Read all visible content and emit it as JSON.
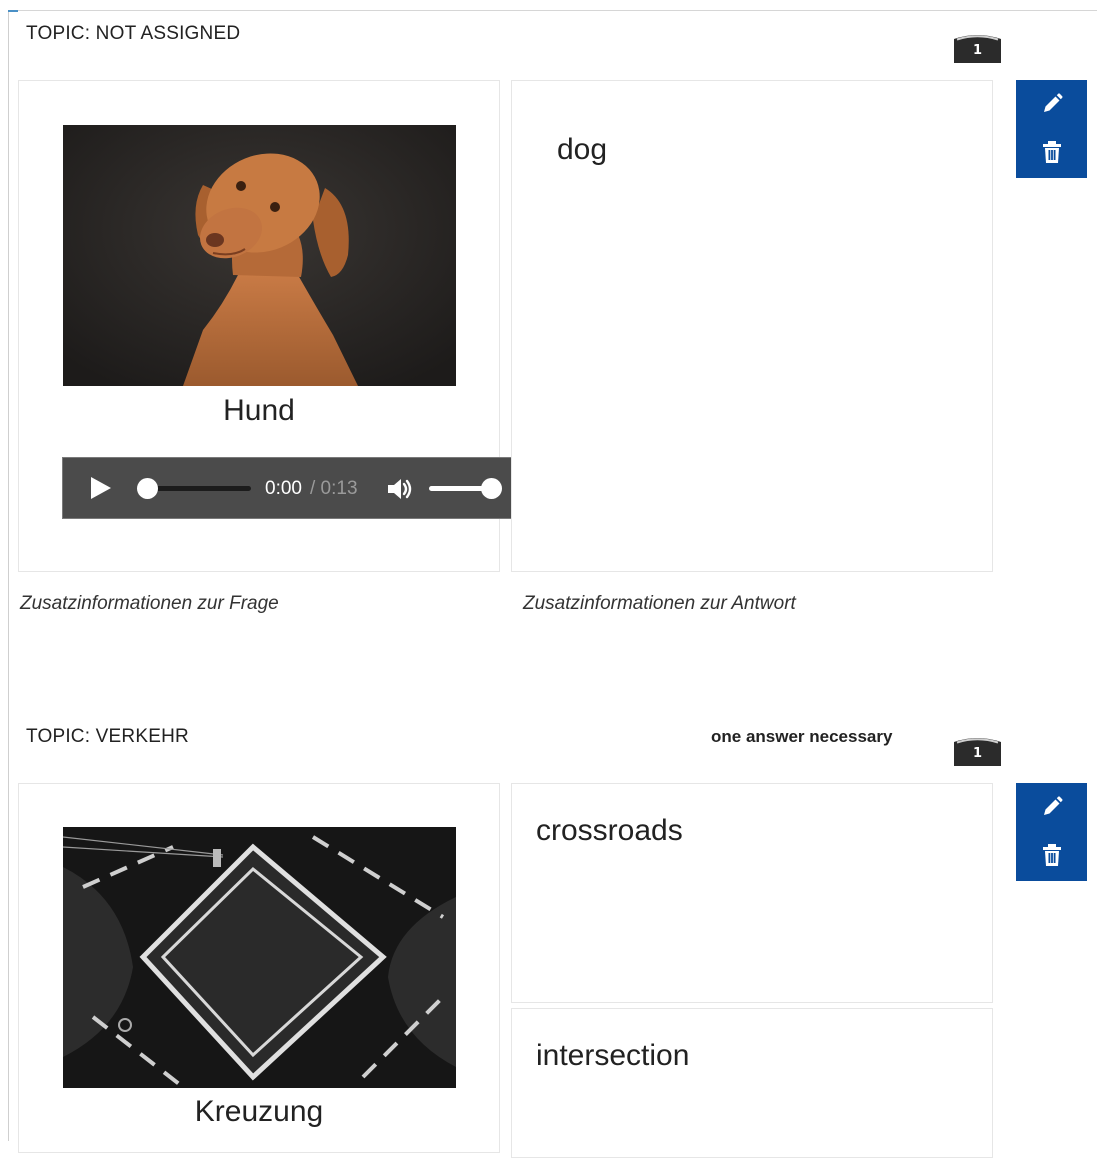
{
  "cards": [
    {
      "topic": "TOPIC: NOT ASSIGNED",
      "hint": "",
      "count": "1",
      "question": {
        "caption": "Hund",
        "image": "dog-photo"
      },
      "answers": [
        "dog"
      ],
      "audio": {
        "current": "0:00",
        "duration": "/ 0:13",
        "progress": 0,
        "volume": 1.0
      },
      "extra_question": "Zusatzinformationen zur Frage",
      "extra_answer": "Zusatzinformationen zur Antwort"
    },
    {
      "topic": "TOPIC: VERKEHR",
      "hint": "one answer necessary",
      "count": "1",
      "question": {
        "caption": "Kreuzung",
        "image": "crossroads-photo"
      },
      "answers": [
        "crossroads",
        "intersection"
      ]
    }
  ],
  "icons": {
    "edit": "pencil-icon",
    "delete": "trash-icon",
    "play": "play-icon",
    "volume": "volume-icon"
  },
  "colors": {
    "accent": "#0a4c9c",
    "counter": "#2b2b2b",
    "player": "#4b4b4b"
  }
}
